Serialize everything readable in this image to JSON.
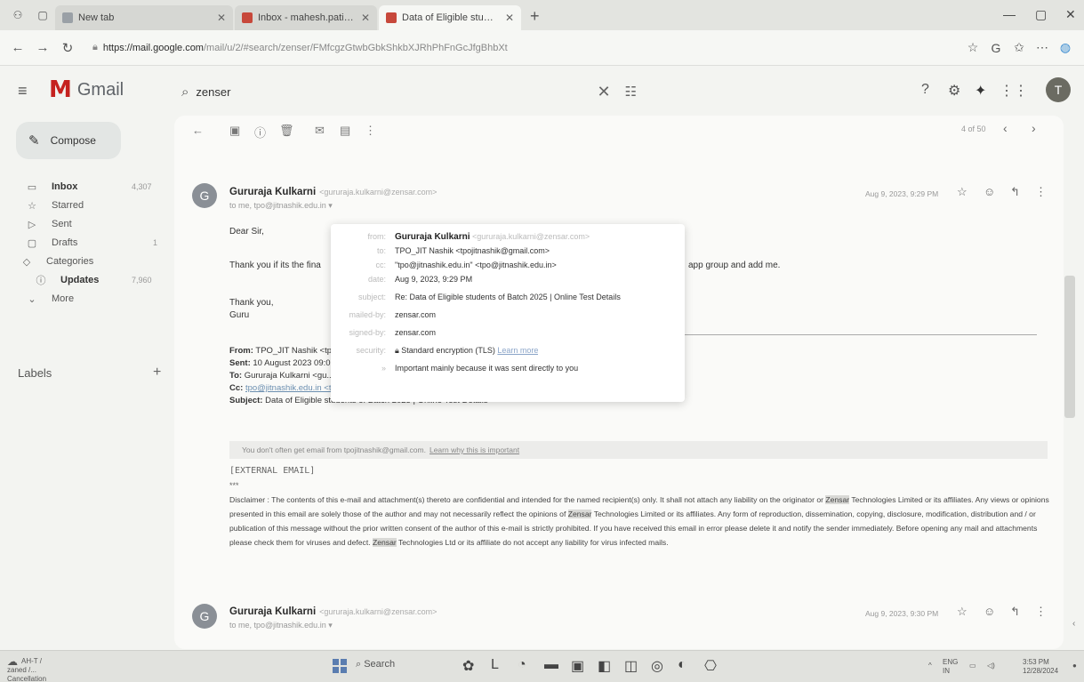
{
  "browser": {
    "tabs": [
      {
        "title": "New tab"
      },
      {
        "title": "Inbox - mahesh.patil900@gmail..."
      },
      {
        "title": "Data of Eligible students of Batch"
      }
    ],
    "url_host": "https://mail.google.com",
    "url_path": "/mail/u/2/#search/zenser/FMfcgzGtwbGbkShkbXJRhPhFnGcJfgBhbXt"
  },
  "gmail": {
    "logo_text": "Gmail",
    "search_query": "zenser",
    "compose_label": "Compose",
    "avatar_initial": "T",
    "pager": "4 of 50"
  },
  "sidebar": {
    "items": [
      {
        "label": "Inbox",
        "count": "4,307",
        "icon": "inbox-icon",
        "glyph": "▭"
      },
      {
        "label": "Starred",
        "count": "",
        "icon": "star-icon",
        "glyph": "☆"
      },
      {
        "label": "Sent",
        "count": "",
        "icon": "send-icon",
        "glyph": "▷"
      },
      {
        "label": "Drafts",
        "count": "1",
        "icon": "draft-icon",
        "glyph": "▢"
      },
      {
        "label": "Categories",
        "count": "",
        "icon": "category-icon",
        "glyph": "◇"
      },
      {
        "label": "Updates",
        "count": "7,960",
        "icon": "info-icon",
        "glyph": "ⓘ"
      },
      {
        "label": "More",
        "count": "",
        "icon": "chevron-down-icon",
        "glyph": "⌄"
      }
    ],
    "labels_heading": "Labels"
  },
  "message1": {
    "sender": "Gururaja Kulkarni",
    "sender_email": "<gururaja.kulkarni@zensar.com>",
    "to": "to me, tpo@jitnashik.edu.in",
    "date": "Aug 9, 2023, 9:29 PM",
    "greeting": "Dear Sir,",
    "body_line": "Thank you if its the fina",
    "body_line_end": "app group and add me.",
    "thanks": "Thank you,",
    "signoff": "Guru",
    "quote": {
      "from_label": "From:",
      "from_value": "TPO_JIT Nashik <tpo...",
      "sent_label": "Sent:",
      "sent_value": "10 August 2023 09:0...",
      "to_label": "To:",
      "to_value": "Gururaja Kulkarni <gu...",
      "cc_label": "Cc:",
      "cc_value": "tpo@jitnashik.edu.in <tpo@jitnashik.edu.in>",
      "subject_label": "Subject:",
      "subject_value": "Data of Eligible students of Batch 2025 | Online Test Details"
    },
    "warning": "You don't often get email from tpojitnashik@gmail.com.",
    "warning_link": "Learn why this is important",
    "external": "[EXTERNAL EMAIL]",
    "dashes": "***",
    "disclaimer_1": "Disclaimer : The contents of this e-mail and attachment(s) thereto are confidential and intended for the named recipient(s) only. It shall not attach any liability on the originator or",
    "zensar": "Zensar",
    "disclaimer_2": "Technologies Limited or its affiliates. Any views or opinions presented in this email are solely those of the author and may not necessarily reflect the opinions of",
    "disclaimer_3": "Technologies Limited or its affiliates. Any form of reproduction, dissemination, copying, disclosure, modification, distribution and / or publication of this message without the prior written consent of the author of this e-mail is strictly prohibited. If you have received this email in error please delete it and notify the sender immediately. Before opening any mail and attachments please check them for viruses and defect.",
    "disclaimer_4": "Technologies Ltd or its affiliate do not accept any liability for virus infected mails."
  },
  "popup": {
    "from_key": "from:",
    "from_name": "Gururaja Kulkarni",
    "from_email": "<gururaja.kulkarni@zensar.com>",
    "to_key": "to:",
    "to_value": "TPO_JIT Nashik <tpojitnashik@gmail.com>",
    "cc_key": "cc:",
    "cc_value": "\"tpo@jitnashik.edu.in\" <tpo@jitnashik.edu.in>",
    "date_key": "date:",
    "date_value": "Aug 9, 2023, 9:29 PM",
    "subject_key": "subject:",
    "subject_value": "Re: Data of Eligible students of Batch 2025 | Online Test Details",
    "mailed_key": "mailed-by:",
    "mailed_value": "zensar.com",
    "signed_key": "signed-by:",
    "signed_value": "zensar.com",
    "security_key": "security:",
    "security_value": "Standard encryption (TLS)",
    "security_link": "Learn more",
    "important_value": "Important mainly because it was sent directly to you"
  },
  "message2": {
    "sender": "Gururaja Kulkarni",
    "sender_email": "<gururaja.kulkarni@zensar.com>",
    "to": "to me, tpo@jitnashik.edu.in",
    "date": "Aug 9, 2023, 9:30 PM"
  },
  "taskbar": {
    "weather_temp": "AH-T / zaned /...",
    "weather_desc": "Cancellation",
    "search_label": "Search",
    "lang": "ENG",
    "lang_sub": "IN",
    "time": "3:53 PM",
    "date": "12/28/2024"
  }
}
